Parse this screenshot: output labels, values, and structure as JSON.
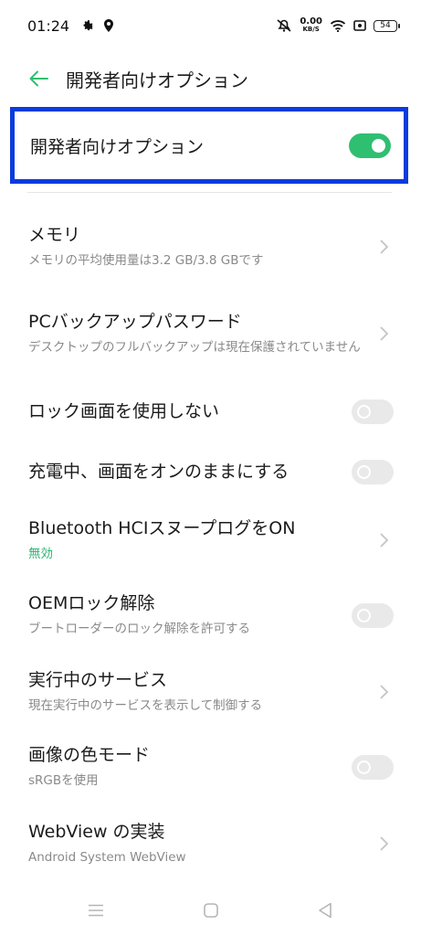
{
  "status_bar": {
    "time": "01:24",
    "net_speed_value": "0.00",
    "net_speed_unit": "KB/S",
    "battery": "54"
  },
  "header": {
    "title": "開発者向けオプション"
  },
  "master_switch": {
    "label": "開発者向けオプション",
    "state": "on"
  },
  "settings": {
    "memory": {
      "title": "メモリ",
      "subtitle": "メモリの平均使用量は3.2 GB/3.8 GBです"
    },
    "pc_backup": {
      "title": "PCバックアップパスワード",
      "subtitle": "デスクトップのフルバックアップは現在保護されていません"
    },
    "no_lock_screen": {
      "title": "ロック画面を使用しない",
      "state": "off"
    },
    "stay_awake": {
      "title": "充電中、画面をオンのままにする",
      "state": "off"
    },
    "bt_hci": {
      "title": "Bluetooth HCIスヌープログをON",
      "subtitle": "無効"
    },
    "oem_unlock": {
      "title": "OEMロック解除",
      "subtitle": "ブートローダーのロック解除を許可する",
      "state": "off"
    },
    "running_services": {
      "title": "実行中のサービス",
      "subtitle": "現在実行中のサービスを表示して制御する"
    },
    "color_mode": {
      "title": "画像の色モード",
      "subtitle": "sRGBを使用",
      "state": "off"
    },
    "webview": {
      "title": "WebView の実装",
      "subtitle": "Android System WebView"
    }
  },
  "colors": {
    "accent": "#2fbf71",
    "highlight_border": "#0a3bdc",
    "subtitle_gray": "#8a8a8a"
  },
  "icons": [
    "gear-icon",
    "location-icon",
    "mute-icon",
    "wifi-icon",
    "screenshot-icon",
    "battery-icon",
    "back-arrow-icon",
    "chevron-right-icon",
    "menu-icon",
    "home-icon",
    "back-triangle-icon"
  ]
}
